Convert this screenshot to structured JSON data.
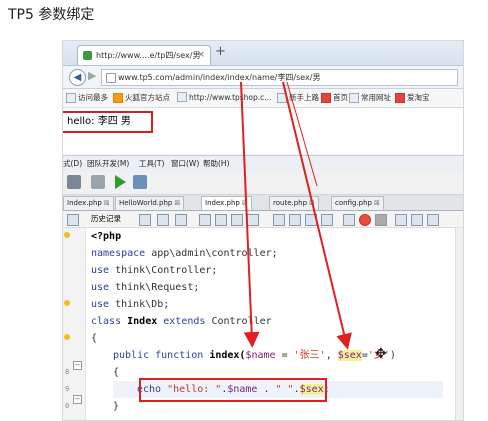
{
  "page": {
    "title": "TP5 参数绑定"
  },
  "browser": {
    "tab_title": "http://www....e/tp四/sex/男",
    "tab_close": "×",
    "new_tab": "+",
    "back_glyph": "◀",
    "forward_glyph": "▶",
    "url": "www.tp5.com/admin/index/index/name/李四/sex/男",
    "bookmarks": [
      {
        "label": "访问最多",
        "icon": "star-icon"
      },
      {
        "label": "火狐官方站点",
        "icon": "firefox-icon"
      },
      {
        "label": "http://www.tpshop.c...",
        "icon": "page-icon"
      },
      {
        "label": "新手上路",
        "icon": "page-icon"
      },
      {
        "label": "首页",
        "icon": "page-icon"
      },
      {
        "label": "常用网址",
        "icon": "folder-icon"
      },
      {
        "label": "爱淘宝",
        "icon": "taobao-icon"
      }
    ]
  },
  "output": {
    "text": "hello: 李四 男"
  },
  "ide": {
    "menu": [
      "式(D)",
      "团队开发(M)",
      "工具(T)",
      "窗口(W)",
      "帮助(H)"
    ],
    "file_tabs": [
      {
        "label": "Index.php",
        "active": false
      },
      {
        "label": "HelloWorld.php",
        "active": false
      },
      {
        "label": "Index.php",
        "active": true
      },
      {
        "label": "route.php",
        "active": false
      },
      {
        "label": "config.php",
        "active": false
      }
    ],
    "tab_close": "⊠",
    "history_label": "历史记录",
    "fold_open": "−",
    "line_numbers": [
      "",
      "",
      "",
      "",
      "",
      "",
      "",
      "",
      "8",
      "9",
      "0",
      ""
    ],
    "code": {
      "l1": "<?php",
      "l2_kw": "namespace",
      "l2_rest": " app\\admin\\controller;",
      "l3_kw": "use",
      "l3_rest": " think\\Controller;",
      "l4_kw": "use",
      "l4_rest": " think\\Request;",
      "l5_kw": "use",
      "l5_rest": " think\\Db;",
      "l6_kw": "class",
      "l6_name": " Index ",
      "l6_kw2": "extends",
      "l6_rest": " Controller",
      "l7": "{",
      "l8_kw": "public function",
      "l8_fn": " index(",
      "l8_var1": "$name",
      "l8_eq1": " = ",
      "l8_str1": "'张三'",
      "l8_comma": ", ",
      "l8_var2a": "$se",
      "l8_var2b": "x",
      "l8_eq2": "=",
      "l8_str2": "'女'",
      "l8_close": ")",
      "l9": "{",
      "l10_kw": "echo",
      "l10_str1": " \"hello: \"",
      "l10_dot1": ".",
      "l10_var1": "$name",
      "l10_dot2": " . ",
      "l10_str2": "\" \"",
      "l10_dot3": ".",
      "l10_var2": "$sex",
      "l10_semi": ";",
      "l11": "}"
    }
  },
  "annotation_color": "#e02020",
  "cursor_glyph": "✥"
}
